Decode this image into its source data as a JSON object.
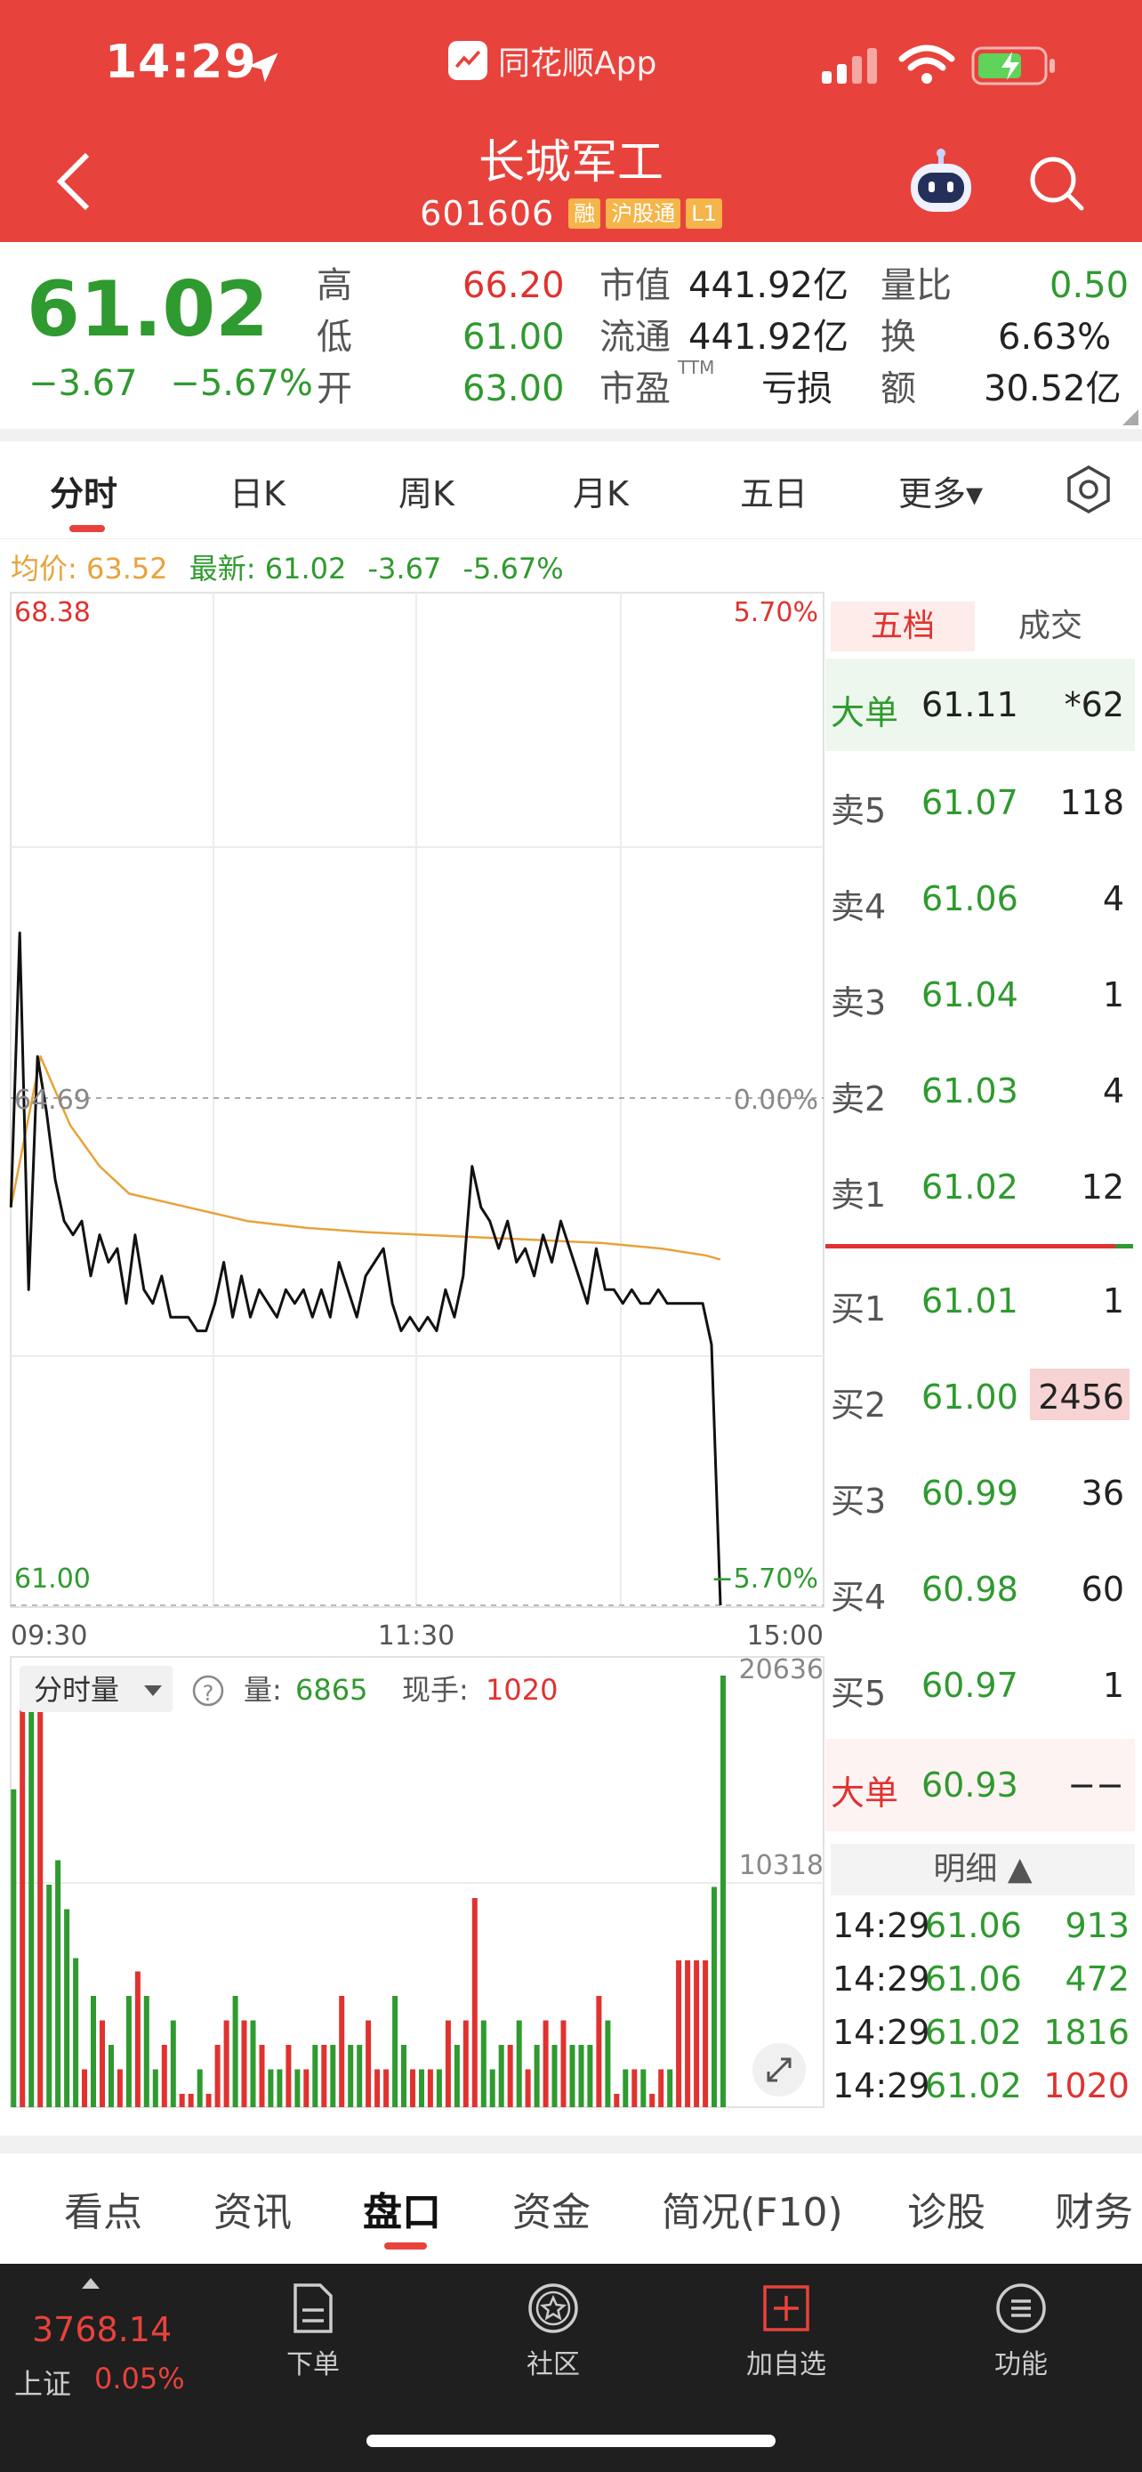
{
  "status_bar": {
    "time": "14:29",
    "app_name": "同花顺App"
  },
  "header": {
    "stock_name": "长城军工",
    "stock_code": "601606",
    "tags": [
      "融",
      "沪股通",
      "L1"
    ]
  },
  "quote": {
    "price": "61.02",
    "change": "−3.67",
    "change_pct": "−5.67%",
    "high_label": "高",
    "high": "66.20",
    "low_label": "低",
    "low": "61.00",
    "open_label": "开",
    "open": "63.00",
    "mktcap_label": "市值",
    "mktcap": "441.92亿",
    "float_label": "流通",
    "float": "441.92亿",
    "pe_label": "市盈",
    "pe_sup": "TTM",
    "pe": "亏损",
    "volratio_label": "量比",
    "volratio": "0.50",
    "turnover_label": "换",
    "turnover": "6.63%",
    "amount_label": "额",
    "amount": "30.52亿"
  },
  "period_tabs": [
    "分时",
    "日K",
    "周K",
    "月K",
    "五日",
    "更多▾"
  ],
  "price_info": {
    "avg_label": "均价:",
    "avg": "63.52",
    "latest_label": "最新:",
    "latest": "61.02",
    "change": "-3.67",
    "change_pct": "-5.67%"
  },
  "chart": {
    "y_max_label": "68.38",
    "y_min_label": "61.00",
    "pct_max_label": "5.70%",
    "pct_zero_label": "0.00%",
    "pct_min_label": "−5.70%",
    "prev_close_label": "64.69",
    "time_labels": [
      "09:30",
      "11:30",
      "15:00"
    ],
    "volume_max_label": "20636",
    "volume_mid_label": "10318",
    "volume_selector": "分时量",
    "volume_label": "量:",
    "volume": "6865",
    "current_hand_label": "现手:",
    "current_hand": "1020"
  },
  "chart_data": {
    "type": "line",
    "ylim": [
      61.0,
      68.38
    ],
    "prev_close": 64.69,
    "series": [
      {
        "name": "最新",
        "x": [
          0,
          3,
          6,
          9,
          12,
          15,
          18,
          21,
          24,
          27,
          30,
          33,
          36,
          39,
          42,
          45,
          48,
          51,
          54,
          57,
          60,
          63,
          66,
          69,
          72,
          75,
          78,
          81,
          84,
          87,
          90,
          93,
          96,
          99,
          102,
          105,
          108,
          111,
          114,
          117,
          120,
          123,
          126,
          129,
          132,
          135,
          138,
          141,
          144,
          147,
          150,
          153,
          156,
          159,
          162,
          165,
          168,
          171,
          174,
          177,
          180,
          183,
          186,
          189,
          192,
          195,
          198,
          201,
          204,
          207,
          210,
          213,
          216,
          219,
          222,
          225,
          228,
          231,
          234,
          237,
          240
        ],
        "values": [
          63.9,
          65.9,
          63.3,
          65.0,
          64.6,
          64.1,
          63.8,
          63.7,
          63.8,
          63.4,
          63.7,
          63.5,
          63.6,
          63.2,
          63.7,
          63.3,
          63.2,
          63.4,
          63.1,
          63.1,
          63.1,
          63.0,
          63.0,
          63.2,
          63.5,
          63.1,
          63.4,
          63.1,
          63.3,
          63.2,
          63.1,
          63.3,
          63.2,
          63.3,
          63.1,
          63.3,
          63.1,
          63.5,
          63.3,
          63.1,
          63.4,
          63.5,
          63.6,
          63.2,
          63.0,
          63.1,
          63.0,
          63.1,
          63.0,
          63.3,
          63.1,
          63.4,
          64.2,
          63.9,
          63.8,
          63.6,
          63.8,
          63.5,
          63.6,
          63.4,
          63.7,
          63.5,
          63.8,
          63.6,
          63.4,
          63.2,
          63.6,
          63.3,
          63.3,
          63.2,
          63.3,
          63.2,
          63.2,
          63.3,
          63.2,
          63.2,
          63.2,
          63.2,
          63.2,
          62.9,
          61.0
        ]
      },
      {
        "name": "均价",
        "x": [
          0,
          10,
          20,
          30,
          40,
          60,
          80,
          100,
          120,
          140,
          160,
          180,
          200,
          220,
          235,
          240
        ],
        "values": [
          63.9,
          65.0,
          64.5,
          64.2,
          64.0,
          63.9,
          63.8,
          63.75,
          63.72,
          63.7,
          63.68,
          63.66,
          63.64,
          63.6,
          63.55,
          63.52
        ]
      }
    ]
  },
  "orderbook": {
    "tab_five": "五档",
    "tab_deals": "成交",
    "big_sell": {
      "label": "大单",
      "price": "61.11",
      "vol": "*62"
    },
    "asks": [
      {
        "label": "卖5",
        "price": "61.07",
        "vol": "118"
      },
      {
        "label": "卖4",
        "price": "61.06",
        "vol": "4"
      },
      {
        "label": "卖3",
        "price": "61.04",
        "vol": "1"
      },
      {
        "label": "卖2",
        "price": "61.03",
        "vol": "4"
      },
      {
        "label": "卖1",
        "price": "61.02",
        "vol": "12"
      }
    ],
    "bids": [
      {
        "label": "买1",
        "price": "61.01",
        "vol": "1"
      },
      {
        "label": "买2",
        "price": "61.00",
        "vol": "2456"
      },
      {
        "label": "买3",
        "price": "60.99",
        "vol": "36"
      },
      {
        "label": "买4",
        "price": "60.98",
        "vol": "60"
      },
      {
        "label": "买5",
        "price": "60.97",
        "vol": "1"
      }
    ],
    "big_buy": {
      "label": "大单",
      "price": "60.93",
      "vol": "−−"
    },
    "detail_header": "明细 ▲",
    "details": [
      {
        "time": "14:29",
        "price": "61.06",
        "vol": "913"
      },
      {
        "time": "14:29",
        "price": "61.06",
        "vol": "472"
      },
      {
        "time": "14:29",
        "price": "61.02",
        "vol": "1816"
      },
      {
        "time": "14:29",
        "price": "61.02",
        "vol": "1020"
      }
    ]
  },
  "section_tabs": [
    "看点",
    "资讯",
    "盘口",
    "资金",
    "简况(F10)",
    "诊股",
    "财务"
  ],
  "bottom_nav": {
    "index_value": "3768.14",
    "index_name": "上证",
    "index_pct": "0.05%",
    "items": [
      {
        "label": "下单"
      },
      {
        "label": "社区"
      },
      {
        "label": "加自选"
      },
      {
        "label": "功能"
      }
    ]
  },
  "colors": {
    "header_red": "#e8423c",
    "up_red": "#e0322f",
    "down_green": "#2f9a2f",
    "avg_orange": "#e8a23a"
  }
}
